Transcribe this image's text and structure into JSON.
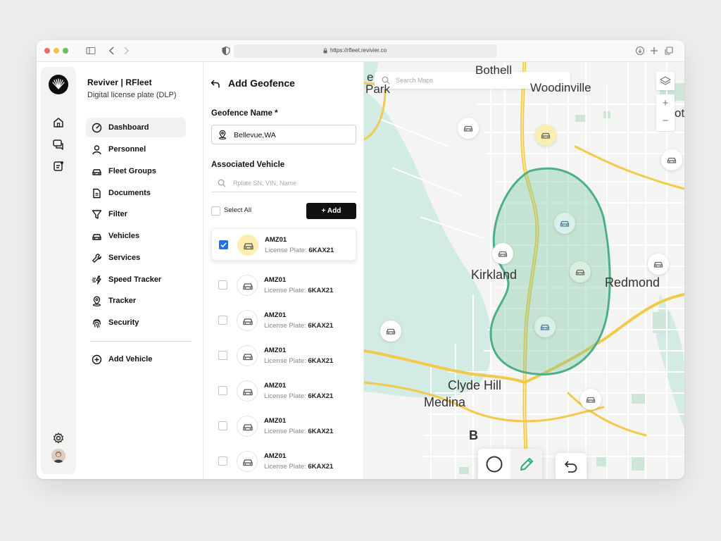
{
  "browser": {
    "url": "https://rfleet.revivier.co",
    "traffic_lights": [
      "#ec6a5e",
      "#f4bf4f",
      "#61c554"
    ]
  },
  "rail": {
    "items": [
      {
        "icon": "home-icon"
      },
      {
        "icon": "chat-icon"
      },
      {
        "icon": "notes-icon"
      }
    ],
    "settings_icon": "gear-icon"
  },
  "brand": {
    "title": "Reviver |  RFleet",
    "subtitle": "Digital license plate (DLP)"
  },
  "nav": {
    "items": [
      {
        "label": "Dashboard",
        "icon": "dashboard-icon",
        "active": true
      },
      {
        "label": "Personnel",
        "icon": "person-icon"
      },
      {
        "label": "Fleet Groups",
        "icon": "car-icon"
      },
      {
        "label": "Documents",
        "icon": "document-icon"
      },
      {
        "label": "Filter",
        "icon": "filter-icon"
      },
      {
        "label": "Vehicles",
        "icon": "car-icon"
      },
      {
        "label": "Services",
        "icon": "wrench-icon"
      },
      {
        "label": "Speed Tracker",
        "icon": "speed-icon"
      },
      {
        "label": "Tracker",
        "icon": "location-icon"
      },
      {
        "label": "Security",
        "icon": "fingerprint-icon"
      }
    ],
    "add_vehicle": "Add Vehicle"
  },
  "panel": {
    "title": "Add Geofence",
    "name_label": "Geofence Name *",
    "name_value": "Bellevue,WA",
    "associated_label": "Associated Vehicle",
    "search_placeholder": "Rplate SN, VIN, Name",
    "select_all": "Select All",
    "add_button": "+ Add",
    "plate_label": "License Plate:",
    "vehicles": [
      {
        "name": "AMZ01",
        "plate": "6KAX21",
        "checked": true
      },
      {
        "name": "AMZ01",
        "plate": "6KAX21",
        "checked": false
      },
      {
        "name": "AMZ01",
        "plate": "6KAX21",
        "checked": false
      },
      {
        "name": "AMZ01",
        "plate": "6KAX21",
        "checked": false
      },
      {
        "name": "AMZ01",
        "plate": "6KAX21",
        "checked": false
      },
      {
        "name": "AMZ01",
        "plate": "6KAX21",
        "checked": false
      },
      {
        "name": "AMZ01",
        "plate": "6KAX21",
        "checked": false
      }
    ]
  },
  "map": {
    "search_placeholder": "Search Maps",
    "zoom_in": "+",
    "zoom_out": "−",
    "labels": {
      "bothell": "Bothell",
      "park": "Park",
      "woodinville": "Woodinville",
      "kirkland": "Kirkland",
      "redmond": "Redmond",
      "clyde_hill": "Clyde Hill",
      "medina": "Medina",
      "bellevue_partial": "B",
      "edge_partial": "ot",
      "edge_left": "e"
    },
    "colors": {
      "geofence_stroke": "#4caf8a",
      "geofence_fill": "#c6e8d5",
      "water": "#d3ebe5",
      "highway": "#f3c94b"
    },
    "tools": {
      "circle": "circle-tool-icon",
      "draw": "pencil-icon",
      "undo": "undo-icon"
    }
  }
}
